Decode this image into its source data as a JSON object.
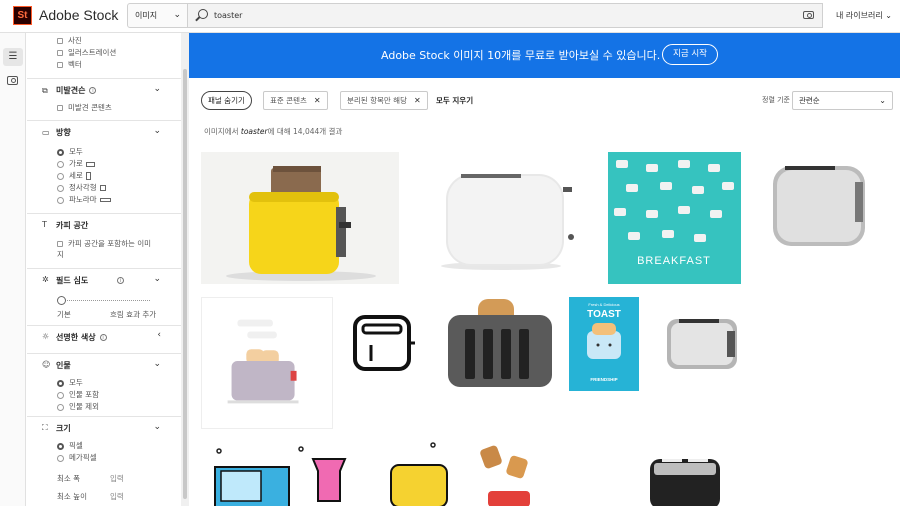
{
  "header": {
    "brand": "Adobe Stock",
    "scope": "이미지",
    "query": "toaster",
    "library": "내 라이브러리"
  },
  "sidebar": {
    "content_types": [
      "사진",
      "일러스트레이션",
      "벡터"
    ],
    "unreleased": {
      "title": "미발견슨",
      "option": "미발견 콘텐츠"
    },
    "orientation": {
      "title": "방향",
      "options": [
        "모두",
        "가로",
        "세로",
        "정사각형",
        "파노라마"
      ]
    },
    "copy_space": {
      "title": "카피 공간",
      "option": "카피 공간을 포함하는 이미지"
    },
    "depth": {
      "title": "필드 심도",
      "left": "기본",
      "right": "흐림 효과 추가"
    },
    "vivid": {
      "title": "선명한 색상"
    },
    "people": {
      "title": "인물",
      "options": [
        "모두",
        "인물 포함",
        "인물 제외"
      ]
    },
    "size": {
      "title": "크기",
      "options": [
        "픽셀",
        "메가픽셀"
      ],
      "min_width_label": "최소 폭",
      "min_height_label": "최소 높이",
      "input_placeholder": "입력"
    }
  },
  "banner": {
    "text": "Adobe Stock 이미지 10개를 무료로 받아보실 수 있습니다.",
    "button": "지금 시작"
  },
  "filters": {
    "hide_panel": "패널 숨기기",
    "chips": [
      "표준 콘텐츠",
      "분리된 항목만 해당"
    ],
    "clear_all": "모두 지우기",
    "sort_label": "정렬 기준",
    "sort_value": "관련순"
  },
  "results": {
    "prefix": "이미지에서 ",
    "term": "toaster",
    "suffix": "에 대해 14,044개 결과"
  },
  "colors": {
    "accent": "#1473e6",
    "brand_orange": "#ff6a3d"
  },
  "tiles": {
    "breakfast_title": "BREAKFAST",
    "toast_title": "TOAST",
    "toast_sub": "Fresh & Delicious",
    "toast_footer": "FRIENDSHIP"
  }
}
